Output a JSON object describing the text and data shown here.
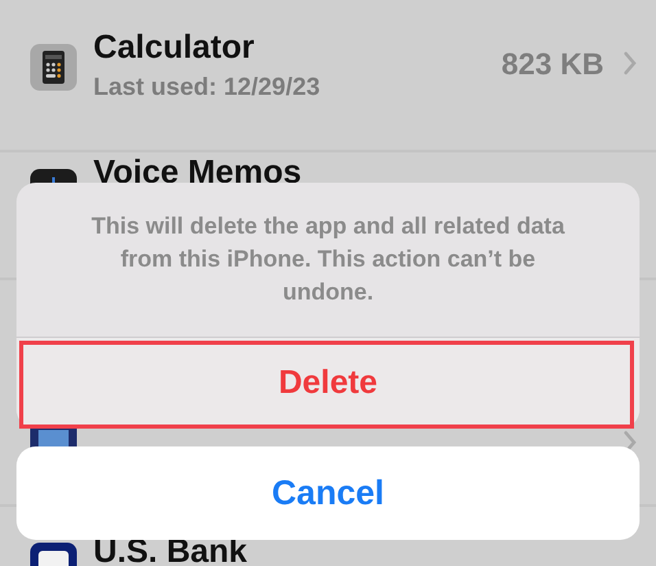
{
  "app_list": [
    {
      "name": "Calculator",
      "last_used": "Last used: 12/29/23",
      "size": "823 KB"
    },
    {
      "name": "Voice Memos"
    },
    {
      "name": "U.S. Bank"
    }
  ],
  "action_sheet": {
    "message": "This will delete the app and all related data from this iPhone. This action can’t be undone.",
    "delete_button": {
      "label": "Delete",
      "highlighted": true
    },
    "cancel_button": {
      "label": "Cancel"
    }
  }
}
